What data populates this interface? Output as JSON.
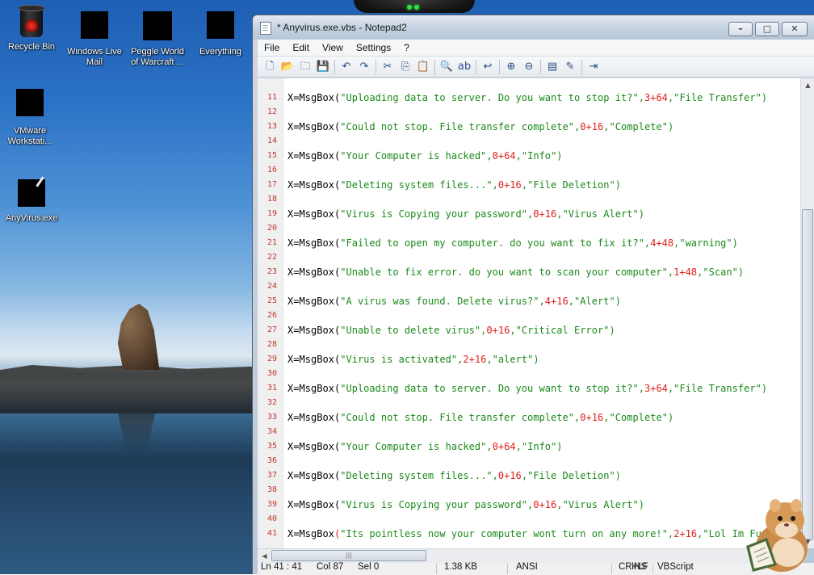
{
  "desktop": {
    "icons": [
      {
        "label": "Recycle Bin"
      },
      {
        "label": "Windows Live Mail"
      },
      {
        "label": "Peggle World of Warcraft ..."
      },
      {
        "label": "Everything"
      },
      {
        "label": "VMware Workstati..."
      },
      {
        "label": "AnyVirus.exe"
      }
    ]
  },
  "window": {
    "title": "* Anyvirus.exe.vbs - Notepad2",
    "controls": {
      "minimize": "–",
      "maximize": "□",
      "close": "✕"
    },
    "menu": [
      "File",
      "Edit",
      "View",
      "Settings",
      "?"
    ]
  },
  "toolbar": [
    {
      "icon": "new-file-icon",
      "glyph": "🗋"
    },
    {
      "icon": "open-folder-icon",
      "glyph": "📂"
    },
    {
      "icon": "browse-icon",
      "glyph": "🗀"
    },
    {
      "icon": "save-icon",
      "glyph": "💾"
    },
    {
      "sep": true
    },
    {
      "icon": "undo-icon",
      "glyph": "↶"
    },
    {
      "icon": "redo-icon",
      "glyph": "↷"
    },
    {
      "sep": true
    },
    {
      "icon": "cut-icon",
      "glyph": "✂"
    },
    {
      "icon": "copy-icon",
      "glyph": "⎘"
    },
    {
      "icon": "paste-icon",
      "glyph": "📋"
    },
    {
      "sep": true
    },
    {
      "icon": "find-icon",
      "glyph": "🔍"
    },
    {
      "icon": "replace-icon",
      "glyph": "ab"
    },
    {
      "sep": true
    },
    {
      "icon": "word-wrap-icon",
      "glyph": "↩"
    },
    {
      "sep": true
    },
    {
      "icon": "zoom-in-icon",
      "glyph": "⊕"
    },
    {
      "icon": "zoom-out-icon",
      "glyph": "⊖"
    },
    {
      "sep": true
    },
    {
      "icon": "scheme-icon",
      "glyph": "▤"
    },
    {
      "icon": "customize-icon",
      "glyph": "✎"
    },
    {
      "sep": true
    },
    {
      "icon": "exit-icon",
      "glyph": "⇥"
    }
  ],
  "editor": {
    "lines": [
      {
        "n": "11",
        "s": "Uploading data to server. Do you want to stop it?",
        "v": "3+64",
        "t": "File Transfer"
      },
      {
        "n": "12"
      },
      {
        "n": "13",
        "s": "Could not stop. File transfer complete",
        "v": "0+16",
        "t": "Complete"
      },
      {
        "n": "14"
      },
      {
        "n": "15",
        "s": "Your Computer is hacked",
        "v": "0+64",
        "t": "Info"
      },
      {
        "n": "16"
      },
      {
        "n": "17",
        "s": "Deleting system files...",
        "v": "0+16",
        "t": "File Deletion"
      },
      {
        "n": "18"
      },
      {
        "n": "19",
        "s": "Virus is Copying your password",
        "v": "0+16",
        "t": "Virus Alert"
      },
      {
        "n": "20"
      },
      {
        "n": "21",
        "s": "Failed to open my computer. do you want to fix it?",
        "v": "4+48",
        "t": "warning"
      },
      {
        "n": "22"
      },
      {
        "n": "23",
        "s": "Unable to fix error. do you want to scan your computer",
        "v": "1+48",
        "t": "Scan"
      },
      {
        "n": "24"
      },
      {
        "n": "25",
        "s": "A virus was found. Delete virus?",
        "v": "4+16",
        "t": "Alert"
      },
      {
        "n": "26"
      },
      {
        "n": "27",
        "s": "Unable to delete virus",
        "v": "0+16",
        "t": "Critical Error"
      },
      {
        "n": "28"
      },
      {
        "n": "29",
        "s": "Virus is activated",
        "v": "2+16",
        "t": "alert"
      },
      {
        "n": "30"
      },
      {
        "n": "31",
        "s": "Uploading data to server. Do you want to stop it?",
        "v": "3+64",
        "t": "File Transfer"
      },
      {
        "n": "32"
      },
      {
        "n": "33",
        "s": "Could not stop. File transfer complete",
        "v": "0+16",
        "t": "Complete"
      },
      {
        "n": "34"
      },
      {
        "n": "35",
        "s": "Your Computer is hacked",
        "v": "0+64",
        "t": "Info"
      },
      {
        "n": "36"
      },
      {
        "n": "37",
        "s": "Deleting system files...",
        "v": "0+16",
        "t": "File Deletion"
      },
      {
        "n": "38"
      },
      {
        "n": "39",
        "s": "Virus is Copying your password",
        "v": "0+16",
        "t": "Virus Alert"
      },
      {
        "n": "40"
      },
      {
        "n": "41",
        "s": "Its pointless now your computer wont turn on any more!",
        "v": "2+16",
        "t": "Lol Im Funny",
        "last": true
      }
    ],
    "prefix": "X=MsgBox("
  },
  "status": {
    "position": "Ln 41 : 41",
    "col": "Col 87",
    "sel": "Sel 0",
    "size": "1.38 KB",
    "encoding": "ANSI",
    "eol": "CR+LF",
    "mode": "INS",
    "lexer": "VBScript"
  },
  "colors": {
    "string": "#1a8a1a",
    "number": "#e0201c",
    "line_number": "#c0392b"
  }
}
